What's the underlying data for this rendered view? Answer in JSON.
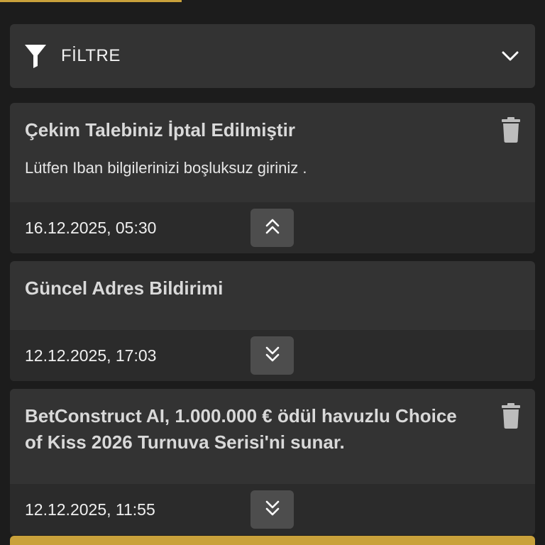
{
  "filter": {
    "label": "FİLTRE",
    "icon": "filter-icon",
    "toggle_icon": "chevron-down-icon"
  },
  "notifications": [
    {
      "title": "Çekim Talebiniz İptal Edilmiştir",
      "message": "Lütfen Iban bilgilerinizi boşluksuz giriniz .",
      "date": "16.12.2025, 05:30",
      "expanded": true,
      "deletable": true
    },
    {
      "title": "Güncel Adres Bildirimi",
      "message": "",
      "date": "12.12.2025, 17:03",
      "expanded": false,
      "deletable": false
    },
    {
      "title": "BetConstruct AI, 1.000.000 € ödül havuzlu Choice of Kiss 2026 Turnuva Serisi'ni sunar.",
      "message": "",
      "date": "12.12.2025, 11:55",
      "expanded": false,
      "deletable": true
    }
  ],
  "colors": {
    "accent": "#c9a13b",
    "background": "#1c1c1c",
    "card": "#333333",
    "card_footer": "#2b2b2b",
    "button": "#4d4d4d"
  }
}
